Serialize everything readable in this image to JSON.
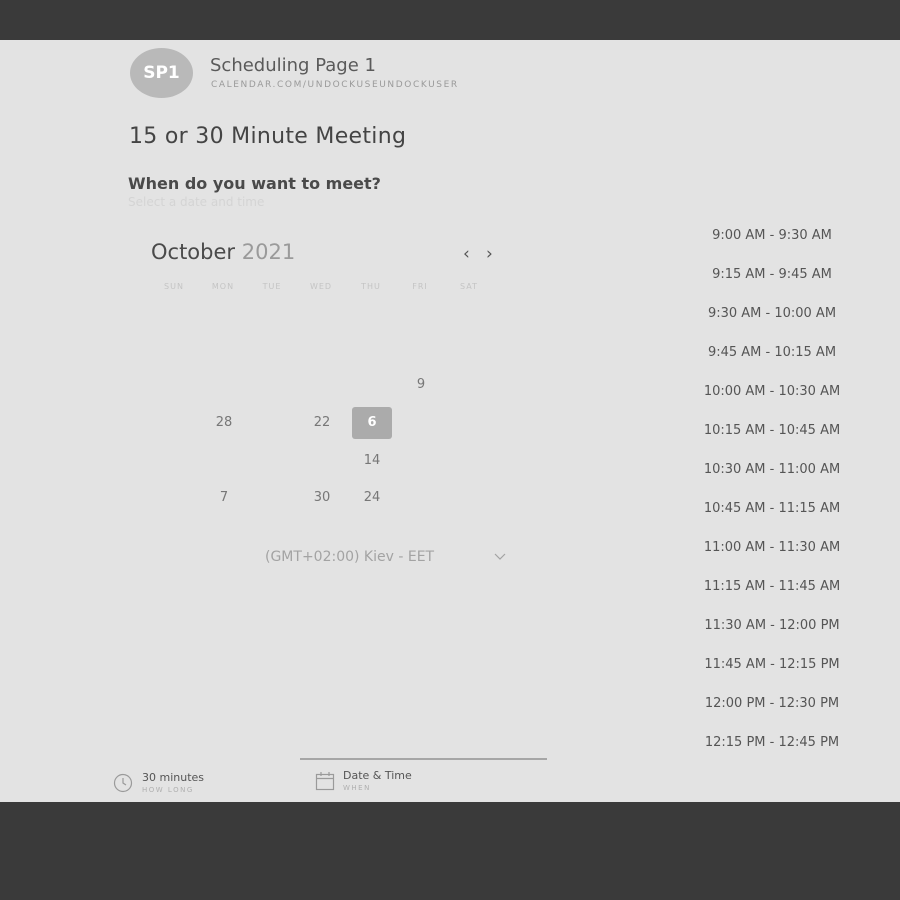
{
  "header": {
    "avatar_initials": "SP1",
    "page_name": "Scheduling Page 1",
    "url": "CALENDAR.COM/UNDOCKUSEUNDOCKUSER"
  },
  "meeting": {
    "title": "15 or 30 Minute Meeting",
    "question": "When do you want to meet?",
    "hint": "Select a date and time"
  },
  "calendar": {
    "month": "October",
    "year": "2021",
    "prev_icon": "chevron-left-icon",
    "next_icon": "chevron-right-icon",
    "weekdays": [
      "SUN",
      "MON",
      "TUE",
      "WED",
      "THU",
      "FRI",
      "SAT"
    ],
    "days": [
      "9",
      "28",
      "22",
      "6",
      "14",
      "7",
      "30",
      "24"
    ],
    "selected_day": "6"
  },
  "timezone": {
    "label": "(GMT+02:00) Kiev - EET",
    "icon": "chevron-down-icon"
  },
  "time_slots": [
    "9:00 AM - 9:30 AM",
    "9:15 AM - 9:45 AM",
    "9:30 AM - 10:00 AM",
    "9:45 AM - 10:15 AM",
    "10:00 AM - 10:30 AM",
    "10:15 AM - 10:45 AM",
    "10:30 AM - 11:00 AM",
    "10:45 AM - 11:15 AM",
    "11:00 AM - 11:30 AM",
    "11:15 AM - 11:45 AM",
    "11:30 AM - 12:00 PM",
    "11:45 AM - 12:15 PM",
    "12:00 PM - 12:30 PM",
    "12:15 PM - 12:45 PM"
  ],
  "footer": {
    "duration_value": "30 minutes",
    "duration_sub": "HOW LONG",
    "duration_icon": "clock-icon",
    "when_value": "Date & Time",
    "when_sub": "WHEN",
    "when_icon": "calendar-icon"
  },
  "colors": {
    "page_bg": "#e3e3e3",
    "frame_bg": "#3a3a3a",
    "selected_day_bg": "#ababab"
  }
}
